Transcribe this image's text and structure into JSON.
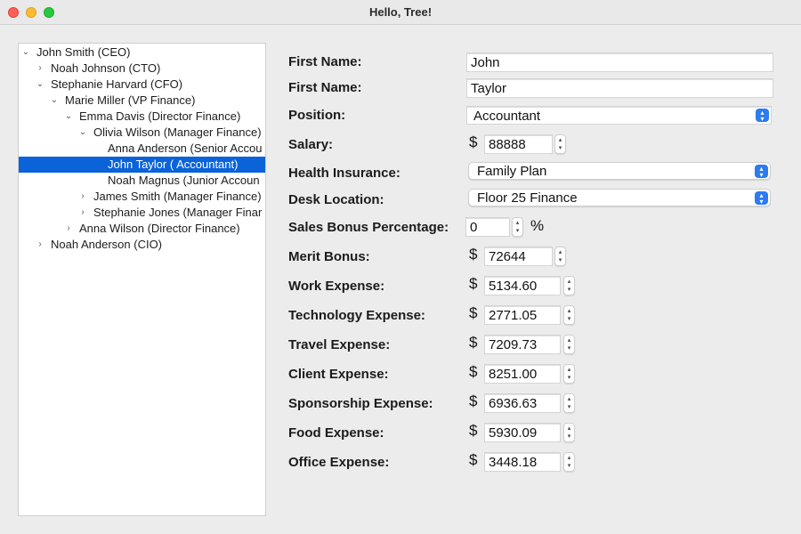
{
  "window": {
    "title": "Hello, Tree!"
  },
  "tree": {
    "rows": [
      {
        "label": "John Smith (CEO)",
        "disclosure": "down"
      },
      {
        "label": "Noah Johnson (CTO)",
        "disclosure": "right"
      },
      {
        "label": "Stephanie Harvard (CFO)",
        "disclosure": "down"
      },
      {
        "label": "Marie Miller (VP Finance)",
        "disclosure": "down"
      },
      {
        "label": "Emma Davis (Director Finance)",
        "disclosure": "down"
      },
      {
        "label": "Olivia Wilson (Manager Finance)",
        "disclosure": "down"
      },
      {
        "label": "Anna Anderson (Senior Accou",
        "disclosure": ""
      },
      {
        "label": "John Taylor ( Accountant)",
        "disclosure": "",
        "selected": true
      },
      {
        "label": "Noah Magnus (Junior Accoun",
        "disclosure": ""
      },
      {
        "label": "James Smith (Manager Finance)",
        "disclosure": "right"
      },
      {
        "label": "Stephanie Jones (Manager Finar",
        "disclosure": "right"
      },
      {
        "label": "Anna Wilson (Director Finance)",
        "disclosure": "right"
      },
      {
        "label": "Noah Anderson (CIO)",
        "disclosure": "right"
      }
    ]
  },
  "form": {
    "first_name_label": "First Name:",
    "first_name_value": "John",
    "last_name_label": "First Name:",
    "last_name_value": "Taylor",
    "position_label": "Position:",
    "position_value": "Accountant",
    "salary_label": "Salary:",
    "salary_value": "88888",
    "health_label": "Health Insurance:",
    "health_value": "Family Plan",
    "desk_label": "Desk Location:",
    "desk_value": "Floor 25 Finance",
    "bonus_pct_label": "Sales Bonus Percentage:",
    "bonus_pct_value": "0",
    "percent_sign": "%",
    "currency_sign": "$",
    "merit_label": "Merit Bonus:",
    "merit_value": "72644",
    "work_label": "Work Expense:",
    "work_value": "5134.60",
    "tech_label": "Technology Expense:",
    "tech_value": "2771.05",
    "travel_label": "Travel Expense:",
    "travel_value": "7209.73",
    "client_label": "Client Expense:",
    "client_value": "8251.00",
    "sponsor_label": "Sponsorship Expense:",
    "sponsor_value": "6936.63",
    "food_label": "Food Expense:",
    "food_value": "5930.09",
    "office_label": "Office Expense:",
    "office_value": "3448.18"
  }
}
